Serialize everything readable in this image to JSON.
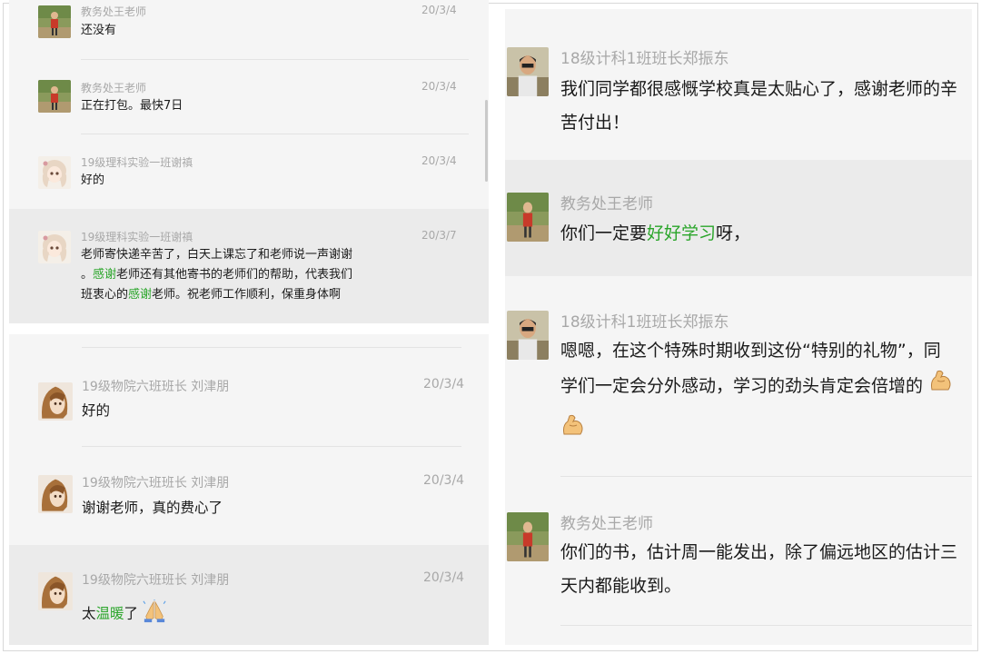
{
  "panel_top": {
    "messages": [
      {
        "sender": "教务处王老师",
        "time": "20/3/4",
        "text": "还没有",
        "avatar": "teacher-avatar"
      },
      {
        "sender": "教务处王老师",
        "time": "20/3/4",
        "text": "正在打包。最快7日",
        "avatar": "teacher-avatar"
      },
      {
        "sender": "19级理科实验一班谢禛",
        "time": "20/3/4",
        "text": "好的",
        "avatar": "anime-girl-avatar"
      },
      {
        "sender": "19级理科实验一班谢禛",
        "time": "20/3/7",
        "line1": "老师寄快递辛苦了，白天上课忘了和老师说一声谢谢",
        "line2_a": "。",
        "line2_green": "感谢",
        "line2_b": "老师还有其他寄书的老师们的帮助，代表我们",
        "line3_a": "班衷心的",
        "line3_green": "感谢",
        "line3_b": "老师。祝老师工作顺利，保重身体啊",
        "avatar": "anime-girl-avatar"
      }
    ]
  },
  "panel_bottom": {
    "messages": [
      {
        "sender": "19级物院六班班长 刘津朋",
        "time": "20/3/4",
        "text": "好的",
        "avatar": "brown-hair-avatar"
      },
      {
        "sender": "19级物院六班班长 刘津朋",
        "time": "20/3/4",
        "text": "谢谢老师，真的费心了",
        "avatar": "brown-hair-avatar"
      },
      {
        "sender": "19级物院六班班长 刘津朋",
        "time": "20/3/4",
        "text_a": "太",
        "text_green": "温暖",
        "text_b": "了",
        "emoji": "folded-hands-emoji",
        "avatar": "brown-hair-avatar"
      }
    ]
  },
  "panel_right": {
    "messages": [
      {
        "sender": "18级计科1班班长郑振东",
        "line1": "我们同学都很感慨学校真是太贴心了，感谢老师的辛",
        "line2": "苦付出！",
        "avatar": "boy-avatar"
      },
      {
        "sender": "教务处王老师",
        "text_a": "你们一定要",
        "text_green": "好好学习",
        "text_b": "呀，",
        "avatar": "teacher-avatar"
      },
      {
        "sender": "18级计科1班班长郑振东",
        "line1": "嗯嗯，在这个特殊时期收到这份“特别的礼物”，同",
        "line2": "学们一定会分外感动，学习的劲头肯定会倍增的",
        "emoji": "flexed-biceps-emoji",
        "avatar": "boy-avatar"
      },
      {
        "sender": "教务处王老师",
        "line1": "你们的书，估计周一能发出，除了偏远地区的估计三",
        "line2": "天内都能收到。",
        "avatar": "teacher-avatar"
      }
    ]
  },
  "colors": {
    "highlight_text": "#2aa52a",
    "meta_text": "#a8a8a8",
    "body_text": "#1a1a1a",
    "panel_bg": "#f5f5f5",
    "selected_bg": "#ebebeb"
  }
}
